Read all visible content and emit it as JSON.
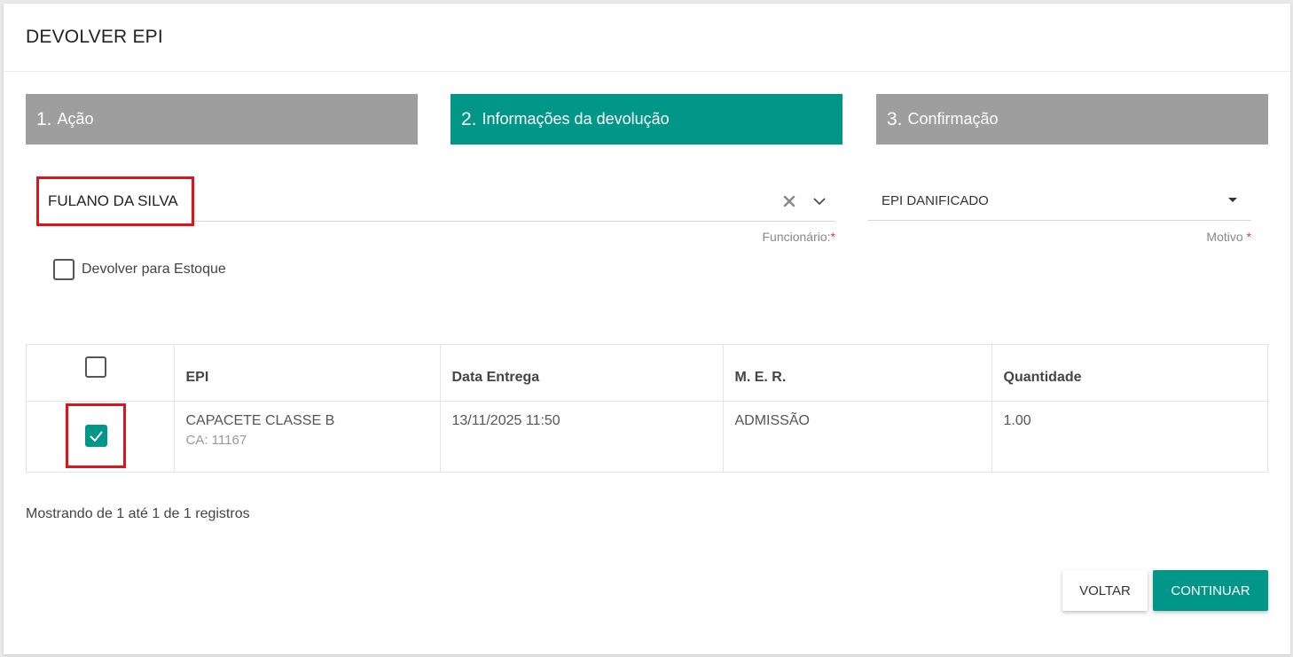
{
  "card": {
    "title": "DEVOLVER EPI"
  },
  "steps": [
    {
      "num": "1.",
      "label": "Ação"
    },
    {
      "num": "2.",
      "label": "Informações da devolução"
    },
    {
      "num": "3.",
      "label": "Confirmação"
    }
  ],
  "form": {
    "employee": {
      "value": "FULANO DA SILVA",
      "label": "Funcionário:",
      "required": "*"
    },
    "motivo": {
      "value": "EPI DANIFICADO",
      "label": "Motivo",
      "required": "*"
    },
    "return_to_stock": {
      "label": "Devolver para Estoque",
      "checked": false
    }
  },
  "table": {
    "columns": [
      "EPI",
      "Data Entrega",
      "M. E. R.",
      "Quantidade"
    ],
    "rows": [
      {
        "selected": true,
        "epi": "CAPACETE CLASSE B",
        "ca": "CA: 11167",
        "date": "13/11/2025 11:50",
        "mer": "ADMISSÃO",
        "qty": "1.00"
      }
    ]
  },
  "footer": {
    "records": "Mostrando de 1 até 1 de 1 registros"
  },
  "buttons": {
    "back": "VOLTAR",
    "continue": "CONTINUAR"
  },
  "colors": {
    "accent": "#009688",
    "inactive_step": "#9e9e9e",
    "highlight": "#e0131b"
  }
}
